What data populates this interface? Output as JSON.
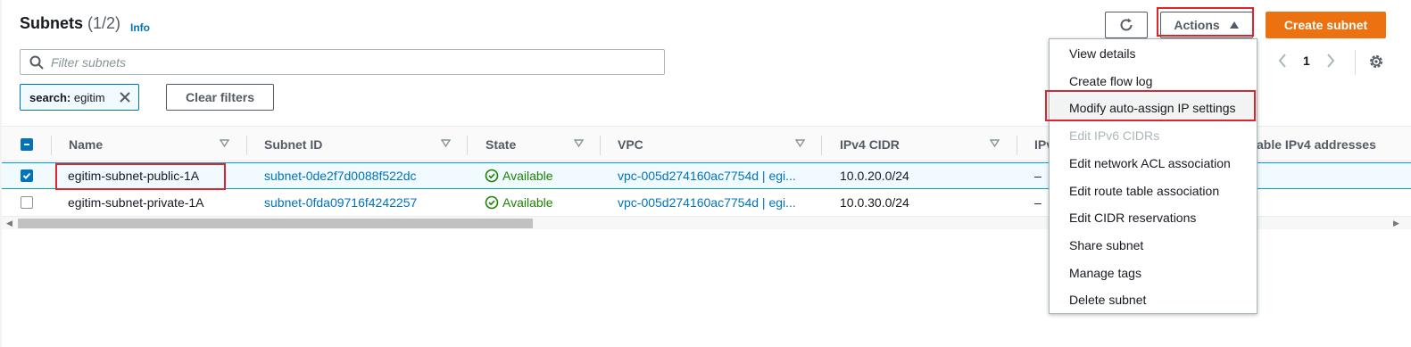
{
  "header": {
    "title": "Subnets",
    "count": "(1/2)",
    "info": "Info"
  },
  "toolbar": {
    "actions_label": "Actions",
    "create_label": "Create subnet",
    "primary_color": "#ec7211"
  },
  "search": {
    "placeholder": "Filter subnets"
  },
  "filter_token": {
    "key": "search:",
    "value": "egitim"
  },
  "clear_filters_label": "Clear filters",
  "pagination": {
    "current_page": "1"
  },
  "table": {
    "columns": [
      "Name",
      "Subnet ID",
      "State",
      "VPC",
      "IPv4 CIDR",
      "IPv",
      "able IPv4 addresses"
    ],
    "rows": [
      {
        "selected": true,
        "name": "egitim-subnet-public-1A",
        "subnet_id": "subnet-0de2f7d0088f522dc",
        "state": "Available",
        "vpc": "vpc-005d274160ac7754d | egi...",
        "ipv4_cidr": "10.0.20.0/24",
        "ipv6": "–"
      },
      {
        "selected": false,
        "name": "egitim-subnet-private-1A",
        "subnet_id": "subnet-0fda09716f4242257",
        "state": "Available",
        "vpc": "vpc-005d274160ac7754d | egi...",
        "ipv4_cidr": "10.0.30.0/24",
        "ipv6": "–"
      }
    ]
  },
  "actions_menu": {
    "items": [
      {
        "label": "View details",
        "disabled": false
      },
      {
        "label": "Create flow log",
        "disabled": false
      },
      {
        "label": "Modify auto-assign IP settings",
        "disabled": false
      },
      {
        "label": "Edit IPv6 CIDRs",
        "disabled": true
      },
      {
        "label": "Edit network ACL association",
        "disabled": false
      },
      {
        "label": "Edit route table association",
        "disabled": false
      },
      {
        "label": "Edit CIDR reservations",
        "disabled": false
      },
      {
        "label": "Share subnet",
        "disabled": false
      },
      {
        "label": "Manage tags",
        "disabled": false
      },
      {
        "label": "Delete subnet",
        "disabled": false
      }
    ]
  },
  "status_color": "#1d8102",
  "link_color": "#0073bb",
  "annotation_color": "#e0232d"
}
